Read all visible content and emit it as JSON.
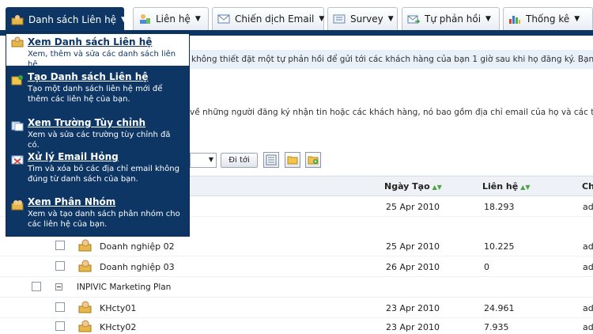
{
  "tabs": [
    {
      "label": "Danh sách Liên hệ",
      "icon": "contacts-icon",
      "active": true
    },
    {
      "label": "Liên hệ",
      "icon": "contact-person-icon",
      "active": false
    },
    {
      "label": "Chiến dịch Email",
      "icon": "envelope-icon",
      "active": false
    },
    {
      "label": "Survey",
      "icon": "survey-icon",
      "active": false
    },
    {
      "label": "Tự phản hồi",
      "icon": "autoresponder-icon",
      "active": false
    },
    {
      "label": "Thống kê",
      "icon": "bar-chart-icon",
      "active": false
    }
  ],
  "menu": {
    "items": [
      {
        "title": "Xem Danh sách Liên hệ",
        "desc": "Xem, thêm và sửa các danh sách liên hệ.",
        "icon": "contacts-icon"
      },
      {
        "title": "Tạo Danh sách Liên hệ",
        "desc": "Tạo một danh sách liên hệ mới để thêm các liên hệ của bạn.",
        "icon": "create-list-icon"
      },
      {
        "title": "Xem Trường Tùy chỉnh",
        "desc": "Xem và sửa các trường tùy chỉnh đã có.",
        "icon": "custom-fields-icon"
      },
      {
        "title": "Xử lý Email Hỏng",
        "desc": "Tìm và xóa bỏ các địa chỉ email không đúng từ danh sách của bạn.",
        "icon": "bounce-email-icon"
      },
      {
        "title": "Xem Phân Nhóm",
        "desc": "Xem và tạo danh sách phân nhóm cho các liên hệ của bạn.",
        "icon": "segments-icon"
      }
    ]
  },
  "page": {
    "info_text": "không thiết đặt một tự phản hồi để gửi tới các khách hàng của bạn 1 giờ sau khi họ đăng ký. Bạn có thể dùng",
    "info_text2": "về những người đăng ký nhận tin hoặc các khách hàng, nó bao gồm địa chỉ email của họ và các thông tin khác",
    "goto_label": "Đi tới"
  },
  "table": {
    "headers": {
      "created": "Ngày Tạo",
      "contacts": "Liên hệ",
      "owner": "Ch"
    },
    "rows": [
      {
        "kind": "child",
        "name": "",
        "created": "25 Apr 2010",
        "contacts": "18.293",
        "owner": "ad"
      },
      {
        "kind": "child",
        "name": "Doanh nghiệp 02",
        "created": "25 Apr 2010",
        "contacts": "10.225",
        "owner": "ad"
      },
      {
        "kind": "child",
        "name": "Doanh nghiệp 03",
        "created": "26 Apr 2010",
        "contacts": "0",
        "owner": "ad"
      },
      {
        "kind": "group",
        "name": "INPIVIC Marketing Plan",
        "created": "",
        "contacts": "",
        "owner": ""
      },
      {
        "kind": "child",
        "name": "KHcty01",
        "created": "23 Apr 2010",
        "contacts": "24.961",
        "owner": "ad"
      },
      {
        "kind": "child",
        "name": "KHcty02",
        "created": "23 Apr 2010",
        "contacts": "7.935",
        "owner": "ad"
      }
    ]
  },
  "colors": {
    "navy": "#0d3665",
    "sort_arrow": "#4da34a"
  }
}
